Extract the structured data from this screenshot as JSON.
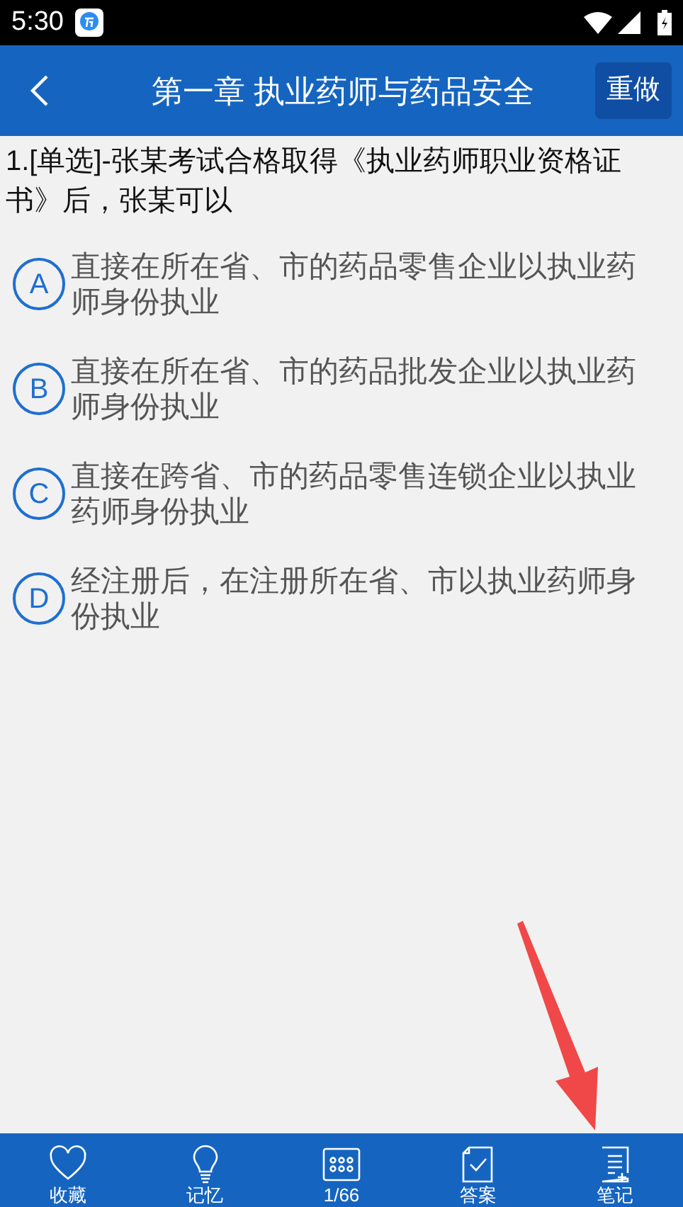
{
  "status_bar": {
    "time": "5:30"
  },
  "header": {
    "title": "第一章 执业药师与药品安全",
    "action": "重做"
  },
  "question": {
    "text": "1.[单选]-张某考试合格取得《执业药师职业资格证书》后，张某可以",
    "options": [
      {
        "letter": "A",
        "text": "直接在所在省、市的药品零售企业以执业药师身份执业",
        "selected": false
      },
      {
        "letter": "B",
        "text": "直接在所在省、市的药品批发企业以执业药师身份执业",
        "selected": false
      },
      {
        "letter": "C",
        "text": "直接在跨省、市的药品零售连锁企业以执业药师身份执业",
        "selected": false
      },
      {
        "letter": "D",
        "text": "经注册后，在注册所在省、市以执业药师身份执业",
        "selected": false
      }
    ]
  },
  "bottom_nav": [
    {
      "kind": "favorite",
      "label": "收藏"
    },
    {
      "kind": "memory",
      "label": "记忆"
    },
    {
      "kind": "grid",
      "label": "1/66"
    },
    {
      "kind": "answer",
      "label": "答案"
    },
    {
      "kind": "notes",
      "label": "笔记"
    }
  ]
}
